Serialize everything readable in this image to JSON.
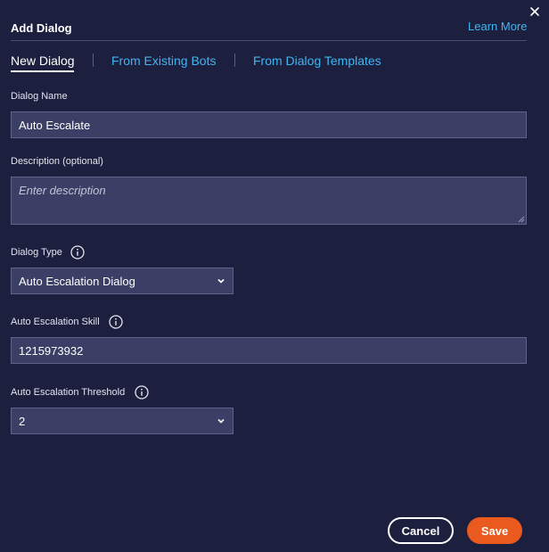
{
  "dialog": {
    "title": "Add Dialog",
    "learn_more": "Learn More"
  },
  "tabs": [
    {
      "label": "New Dialog",
      "active": true
    },
    {
      "label": "From Existing Bots",
      "active": false
    },
    {
      "label": "From Dialog Templates",
      "active": false
    }
  ],
  "form": {
    "dialog_name": {
      "label": "Dialog Name",
      "value": "Auto Escalate"
    },
    "description": {
      "label": "Description (optional)",
      "value": "",
      "placeholder": "Enter description"
    },
    "dialog_type": {
      "label": "Dialog Type",
      "selected": "Auto Escalation Dialog"
    },
    "escalation_skill": {
      "label": "Auto Escalation Skill",
      "value": "1215973932"
    },
    "escalation_threshold": {
      "label": "Auto Escalation Threshold",
      "selected": "2"
    }
  },
  "buttons": {
    "cancel": "Cancel",
    "save": "Save"
  },
  "colors": {
    "background": "#1d1f3f",
    "field": "#3b3f65",
    "link": "#3fb6f0",
    "primary": "#ea5a1e"
  },
  "icons": [
    "close-icon",
    "info-icon",
    "chevron-down-icon"
  ]
}
